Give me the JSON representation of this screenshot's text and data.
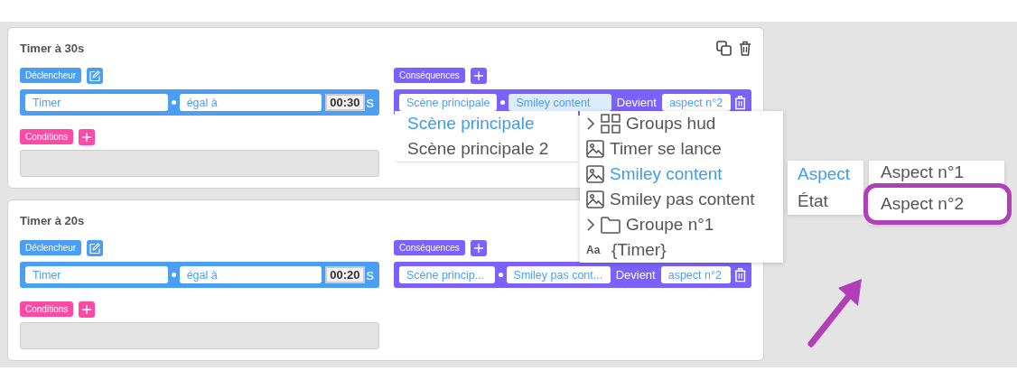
{
  "rules": [
    {
      "title": "Timer à 30s",
      "show_actions": true,
      "trigger": {
        "label": "Déclencheur",
        "fields": [
          "Timer",
          "égal à"
        ],
        "time": "00:30",
        "unit": "s"
      },
      "conditions": {
        "label": "Conditions"
      },
      "consequences": {
        "label": "Conséquences",
        "scene": "Scène principale",
        "object": "Smiley content",
        "object_focused": true,
        "verb": "Devient",
        "value": "aspect n°2"
      }
    },
    {
      "title": "Timer à 20s",
      "show_actions": false,
      "trigger": {
        "label": "Déclencheur",
        "fields": [
          "Timer",
          "égal à"
        ],
        "time": "00:20",
        "unit": "s"
      },
      "conditions": {
        "label": "Conditions"
      },
      "consequences": {
        "label": "Conséquences",
        "scene": "Scène princip...",
        "object": "Smiley pas cont...",
        "object_focused": false,
        "verb": "Devient",
        "value": "aspect n°2"
      }
    }
  ],
  "scene_menu": {
    "items": [
      {
        "label": "Scène principale",
        "selected": true
      },
      {
        "label": "Scène principale 2",
        "selected": false
      }
    ]
  },
  "object_menu": {
    "items": [
      {
        "kind": "group",
        "label": "Groups hud",
        "selected": false
      },
      {
        "kind": "image",
        "label": "Timer se lance",
        "selected": false
      },
      {
        "kind": "image",
        "label": "Smiley content",
        "selected": true
      },
      {
        "kind": "image",
        "label": "Smiley pas content",
        "selected": false
      },
      {
        "kind": "folder",
        "label": "Groupe n°1",
        "selected": false
      },
      {
        "kind": "text",
        "label": "{Timer}",
        "icon_text": "Aa",
        "selected": false
      }
    ]
  },
  "property_menu": {
    "items": [
      {
        "label": "Aspect",
        "selected": true
      },
      {
        "label": "État",
        "selected": false
      }
    ]
  },
  "value_menu": {
    "items": [
      {
        "label": "Aspect n°1",
        "circled": false
      },
      {
        "label": "Aspect n°2",
        "circled": true
      }
    ]
  }
}
